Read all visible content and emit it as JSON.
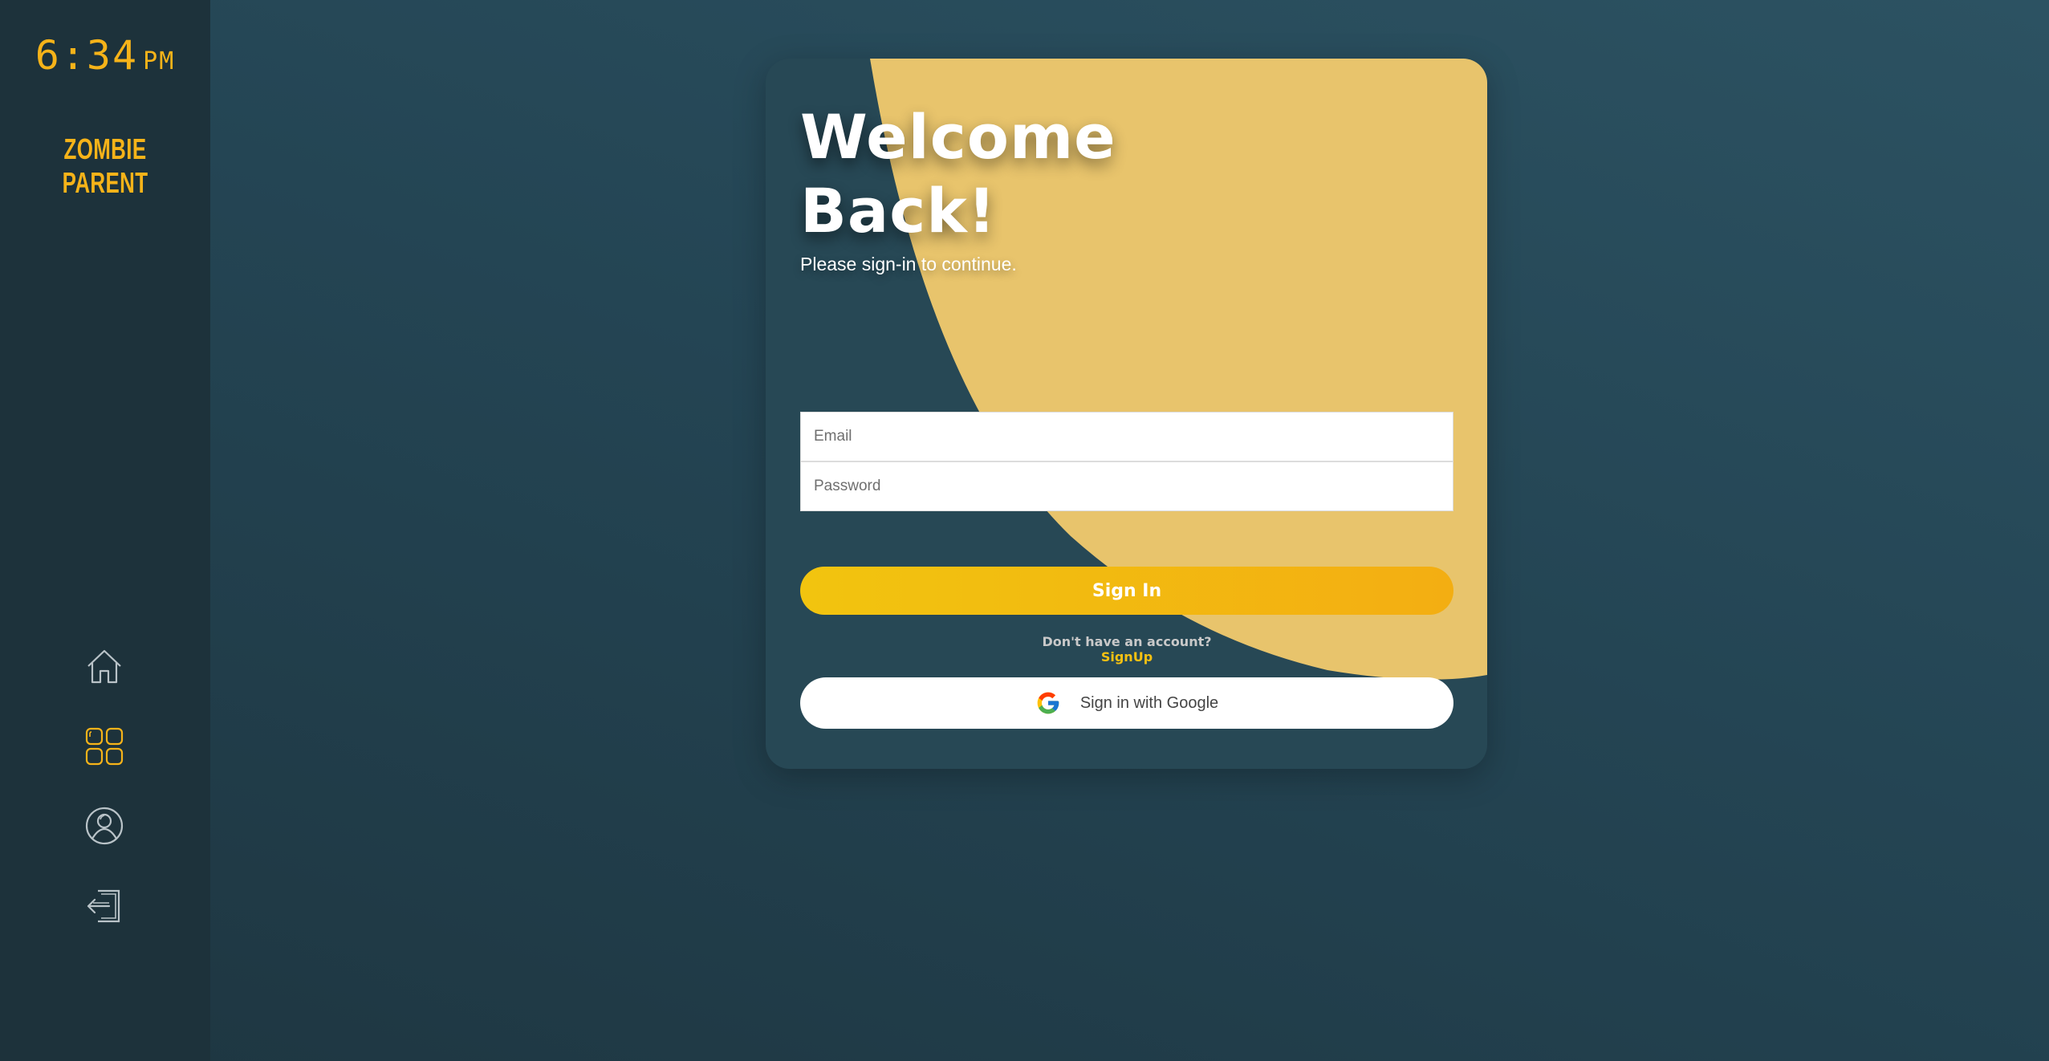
{
  "sidebar": {
    "clock": {
      "time": "6:34",
      "ampm": "PM"
    },
    "brand": "ZOMBIE PARENT",
    "nav": [
      {
        "icon": "home-icon"
      },
      {
        "icon": "grid-icon"
      },
      {
        "icon": "user-icon"
      },
      {
        "icon": "logout-icon"
      }
    ]
  },
  "card": {
    "title_line1": "Welcome",
    "title_line2": "Back!",
    "subtitle": "Please sign-in to continue.",
    "email_placeholder": "Email",
    "password_placeholder": "Password",
    "signin_label": "Sign In",
    "no_account_text": "Don't have an account?",
    "signup_label": "SignUp",
    "google_label": "Sign in with Google"
  },
  "colors": {
    "accent": "#f6b319",
    "card_bg": "#274855",
    "blob": "#e8c46c",
    "sidebar_bg": "#1d323b"
  }
}
